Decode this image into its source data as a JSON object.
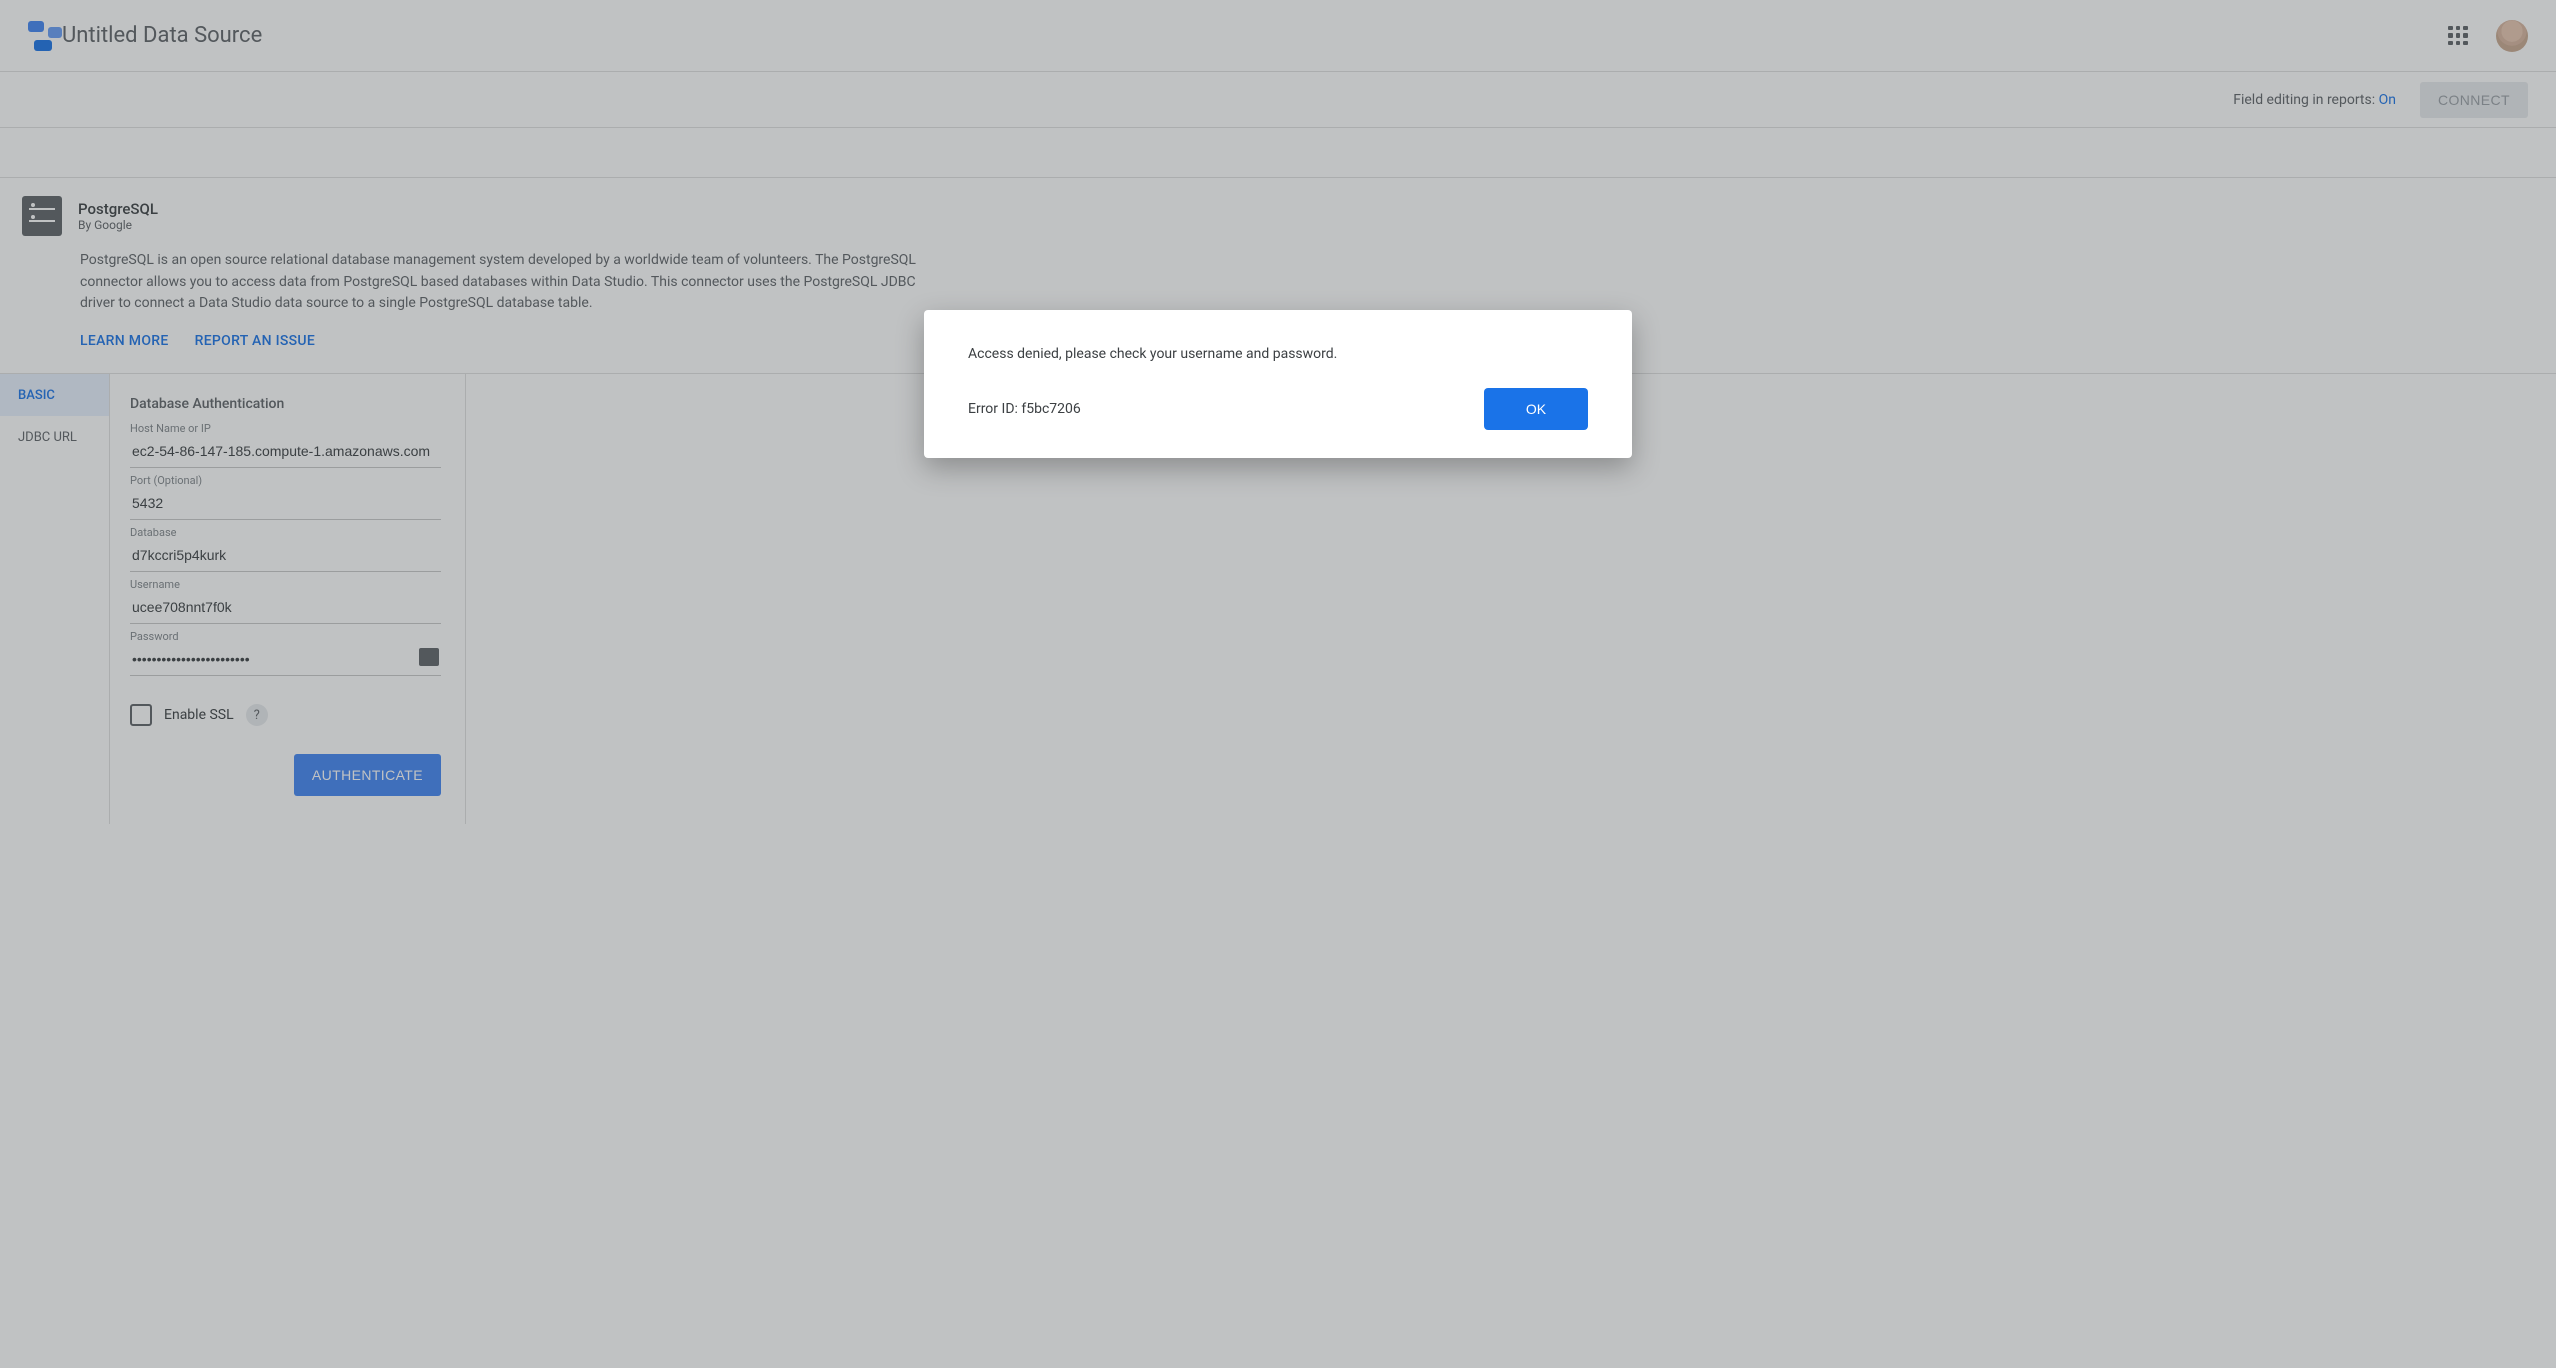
{
  "header": {
    "title": "Untitled Data Source"
  },
  "subheader": {
    "field_editing_label": "Field editing in reports:",
    "field_editing_value": "On",
    "connect_label": "CONNECT"
  },
  "connector": {
    "name": "PostgreSQL",
    "by": "By Google",
    "description": "PostgreSQL is an open source relational database management system developed by a worldwide team of volunteers. The PostgreSQL connector allows you to access data from PostgreSQL based databases within Data Studio. This connector uses the PostgreSQL JDBC driver to connect a Data Studio data source to a single PostgreSQL database table.",
    "learn_more": "LEARN MORE",
    "report_issue": "REPORT AN ISSUE"
  },
  "tabs": {
    "basic": "BASIC",
    "jdbc": "JDBC URL"
  },
  "form": {
    "title": "Database Authentication",
    "host": {
      "label": "Host Name or IP",
      "value": "ec2-54-86-147-185.compute-1.amazonaws.com"
    },
    "port": {
      "label": "Port (Optional)",
      "value": "5432"
    },
    "database": {
      "label": "Database",
      "value": "d7kccri5p4kurk"
    },
    "username": {
      "label": "Username",
      "value": "ucee708nnt7f0k"
    },
    "password": {
      "label": "Password",
      "value": "••••••••••••••••••••••••"
    },
    "enable_ssl": "Enable SSL",
    "help": "?",
    "authenticate": "AUTHENTICATE"
  },
  "dialog": {
    "message": "Access denied, please check your username and password.",
    "error_id": "Error ID: f5bc7206",
    "ok": "OK"
  }
}
